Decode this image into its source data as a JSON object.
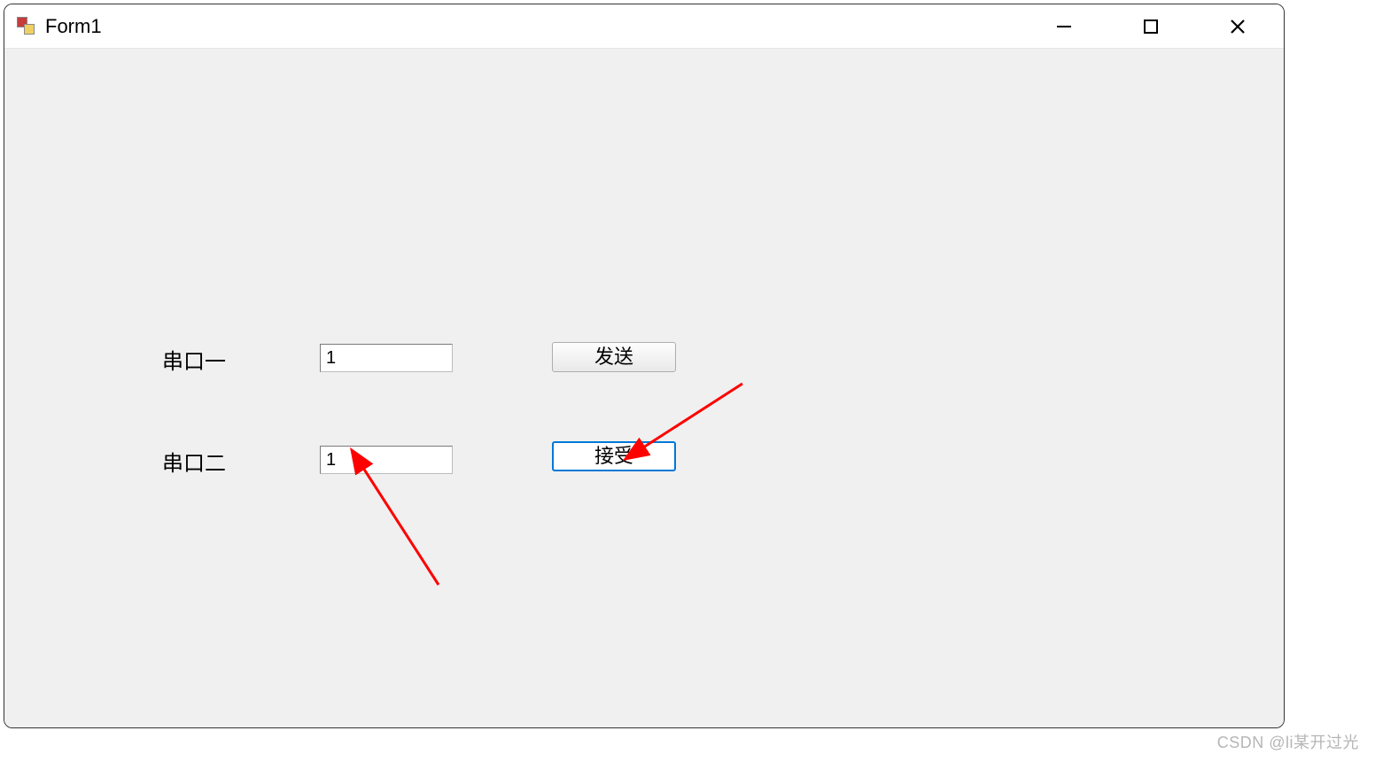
{
  "window": {
    "title": "Form1"
  },
  "form": {
    "row1": {
      "label": "串口一",
      "input_value": "1",
      "button_label": "发送"
    },
    "row2": {
      "label": "串口二",
      "input_value": "1",
      "button_label": "接受"
    }
  },
  "watermark": "CSDN @li某开过光"
}
